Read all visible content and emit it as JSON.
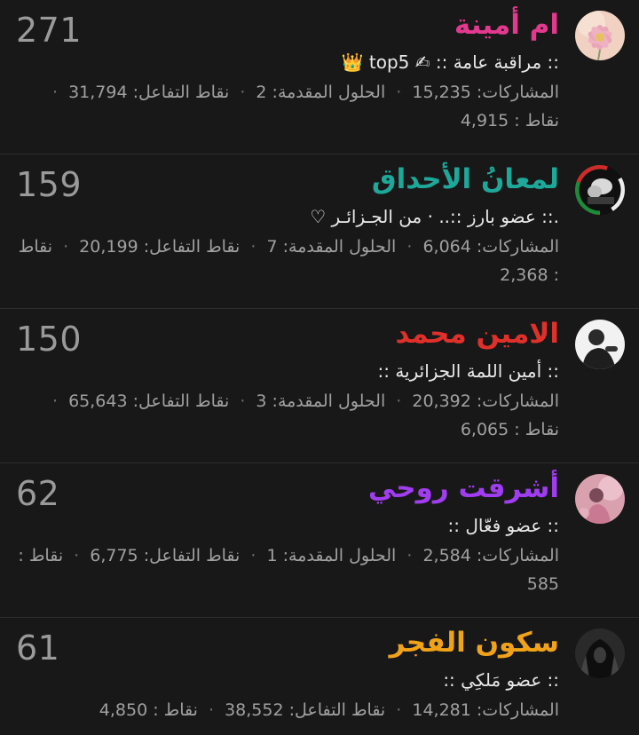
{
  "labels": {
    "posts": "المشاركات:",
    "solutions": "الحلول المقدمة:",
    "reactions": "نقاط التفاعل:",
    "points": "نقاط :",
    "separator": "·"
  },
  "members": [
    {
      "count": "271",
      "name": "ام أمينة",
      "name_color": "#e2398f",
      "title": ":: مراقبة عامة :: ✍ top5 👑",
      "posts": "15,235",
      "solutions": "2",
      "reactions": "31,794",
      "points": "4,915",
      "avatar": "flower-avatar"
    },
    {
      "count": "159",
      "name": "لمعانُ الأحداق",
      "name_color": "#1ea89a",
      "title": ".:: عضو بارز ::.. · من الجـزائـر ♡",
      "posts": "6,064",
      "solutions": "7",
      "reactions": "20,199",
      "points": "2,368",
      "avatar": "algeria-avatar"
    },
    {
      "count": "150",
      "name": "الامين محمد",
      "name_color": "#e0302a",
      "title": ":: أمين اللمة الجزائرية ::",
      "posts": "20,392",
      "solutions": "3",
      "reactions": "65,643",
      "points": "6,065",
      "avatar": "person-avatar"
    },
    {
      "count": "62",
      "name": "أشرقت روحي",
      "name_color": "#a13df0",
      "title": ":: عضو فعّال ::",
      "posts": "2,584",
      "solutions": "1",
      "reactions": "6,775",
      "points": "585",
      "avatar": "pink-avatar"
    },
    {
      "count": "61",
      "name": "سكون الفجر",
      "name_color": "#f0a218",
      "title": ":: عضو مَلكِي ::",
      "posts": "14,281",
      "solutions": "",
      "reactions": "38,552",
      "points": "4,850",
      "avatar": "hooded-avatar"
    }
  ]
}
